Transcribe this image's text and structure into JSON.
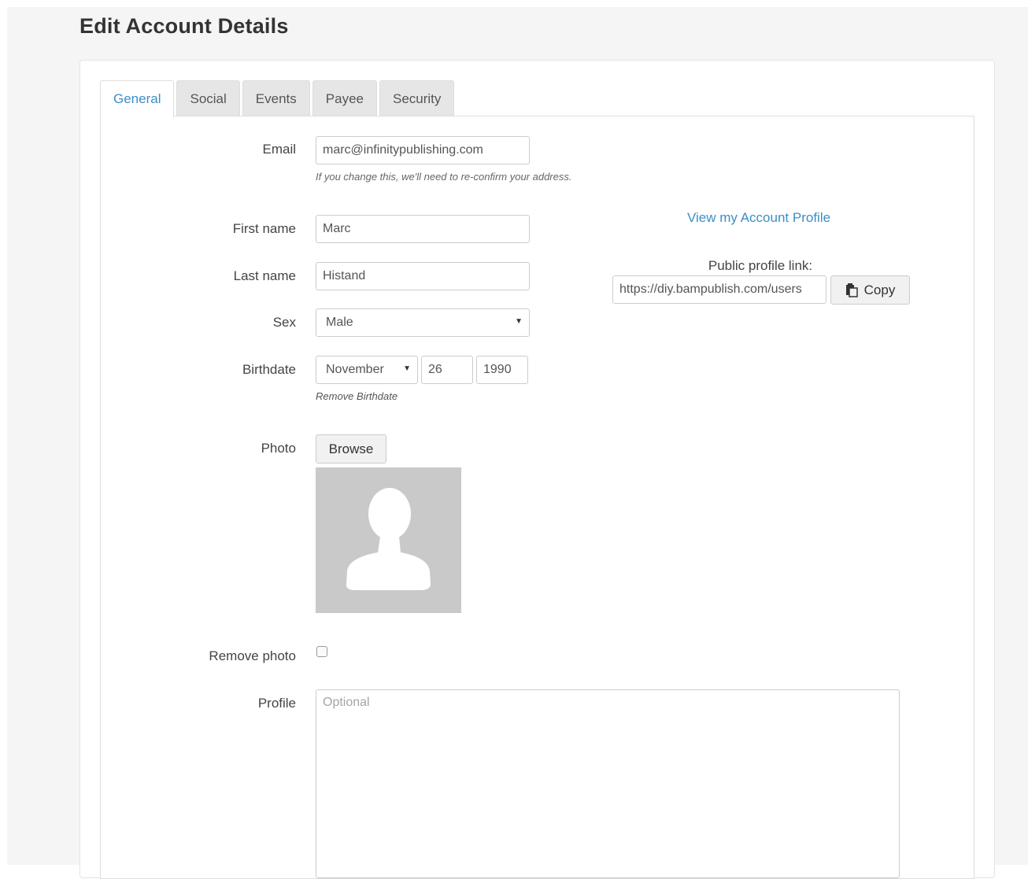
{
  "page_title": "Edit Account Details",
  "tabs": [
    {
      "label": "General",
      "active": true
    },
    {
      "label": "Social",
      "active": false
    },
    {
      "label": "Events",
      "active": false
    },
    {
      "label": "Payee",
      "active": false
    },
    {
      "label": "Security",
      "active": false
    }
  ],
  "form": {
    "email": {
      "label": "Email",
      "value": "marc@infinitypublishing.com",
      "help": "If you change this, we'll need to re-confirm your address."
    },
    "first_name": {
      "label": "First name",
      "value": "Marc"
    },
    "last_name": {
      "label": "Last name",
      "value": "Histand"
    },
    "sex": {
      "label": "Sex",
      "value": "Male"
    },
    "birthdate": {
      "label": "Birthdate",
      "month": "November",
      "day": "26",
      "year": "1990",
      "remove_label": "Remove Birthdate"
    },
    "photo": {
      "label": "Photo",
      "browse_label": "Browse",
      "placeholder_icon": "user-silhouette-icon"
    },
    "remove_photo": {
      "label": "Remove photo",
      "checked": false
    },
    "profile": {
      "label": "Profile",
      "placeholder": "Optional",
      "value": ""
    }
  },
  "side": {
    "view_profile_link": "View my Account Profile",
    "public_link_label": "Public profile link:",
    "public_link_value": "https://diy.bampublish.com/users",
    "copy_label": "Copy",
    "copy_icon": "clipboard-icon"
  },
  "colors": {
    "accent": "#3a8fc8",
    "page_background": "#f5f5f5",
    "tab_inactive": "#e6e6e6",
    "photo_placeholder": "#c9c9c9"
  }
}
